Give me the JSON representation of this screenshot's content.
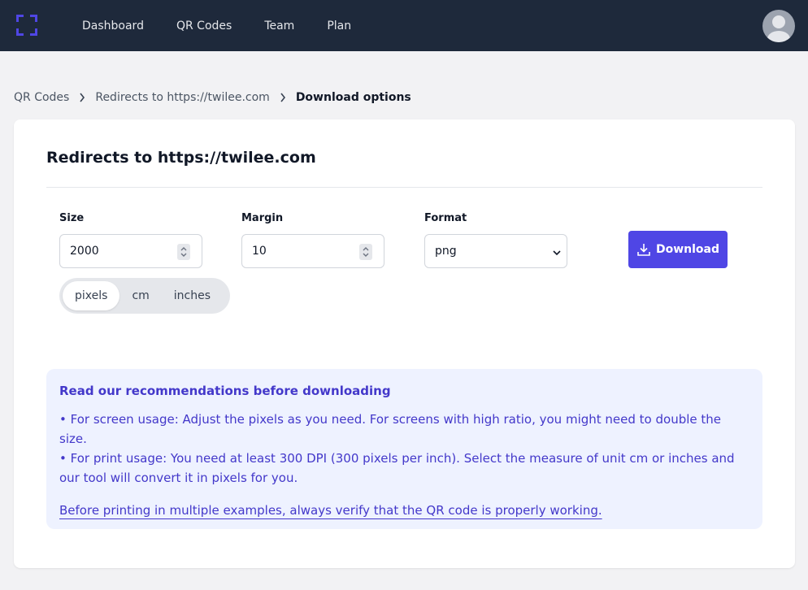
{
  "nav": {
    "items": [
      "Dashboard",
      "QR Codes",
      "Team",
      "Plan"
    ]
  },
  "breadcrumb": {
    "items": [
      "QR Codes",
      "Redirects to https://twilee.com",
      "Download options"
    ]
  },
  "card": {
    "title": "Redirects to https://twilee.com"
  },
  "form": {
    "size_label": "Size",
    "size_value": "2000",
    "margin_label": "Margin",
    "margin_value": "10",
    "format_label": "Format",
    "format_value": "png",
    "download_label": "Download",
    "units": [
      "pixels",
      "cm",
      "inches"
    ],
    "selected_unit": "pixels"
  },
  "notice": {
    "title": "Read our recommendations before downloading",
    "line1": "•  For screen usage: Adjust the pixels as you need. For screens with high ratio, you might need to double the size.",
    "line2": "•  For print usage: You need at least 300 DPI (300 pixels per inch). Select the measure of unit cm or inches and our tool will convert it in pixels for you.",
    "link": "Before printing in multiple examples, always verify that the QR code is properly working."
  },
  "colors": {
    "topbar": "#1e293b",
    "accent": "#4f46e5",
    "notice_bg": "#eef2ff",
    "notice_text": "#4338ca"
  }
}
